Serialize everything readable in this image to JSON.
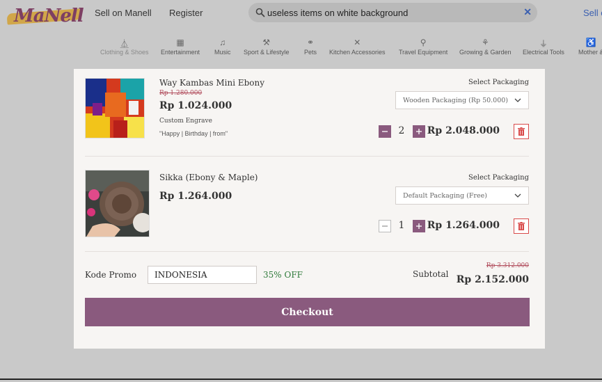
{
  "header": {
    "logo_text": "MaNell",
    "sell_link": "Sell on Manell",
    "register_link": "Register",
    "search": {
      "value": "useless items on white background",
      "placeholder": ""
    },
    "sell_right": "Sell o"
  },
  "categories": [
    {
      "label": "Clothing & Shoes",
      "icon": "hanger-icon"
    },
    {
      "label": "Entertainment",
      "icon": "film-icon"
    },
    {
      "label": "Music",
      "icon": "music-note-icon"
    },
    {
      "label": "Sport & Lifestyle",
      "icon": "dumbbell-icon"
    },
    {
      "label": "Pets",
      "icon": "bone-icon"
    },
    {
      "label": "Kitchen Accessories",
      "icon": "utensils-icon"
    },
    {
      "label": "Travel Equipment",
      "icon": "binoculars-icon"
    },
    {
      "label": "Growing & Garden",
      "icon": "plant-icon"
    },
    {
      "label": "Electrical Tools",
      "icon": "plug-icon"
    },
    {
      "label": "Mother &",
      "icon": "stroller-icon"
    }
  ],
  "cart": {
    "items": [
      {
        "name": "Way Kambas Mini Ebony",
        "original_price": "Rp 1.280.000",
        "price": "Rp 1.024.000",
        "engrave_label": "Custom Engrave",
        "engrave_value": "\"Happy | Birthday | from\"",
        "packaging_label": "Select Packaging",
        "packaging_value": "Wooden Packaging (Rp 50.000)",
        "quantity": "2",
        "line_total": "Rp 2.048.000"
      },
      {
        "name": "Sikka (Ebony & Maple)",
        "price": "Rp 1.264.000",
        "packaging_label": "Select Packaging",
        "packaging_value": "Default Packaging (Free)",
        "quantity": "1",
        "line_total": "Rp 1.264.000"
      }
    ],
    "promo": {
      "label": "Kode Promo",
      "value": "INDONESIA",
      "discount": "35% OFF"
    },
    "subtotal": {
      "label": "Subtotal",
      "original": "Rp 3.312.000",
      "value": "Rp 2.152.000"
    },
    "checkout_label": "Checkout"
  },
  "colors": {
    "accent": "#8a5a7e",
    "danger": "#d94a4a",
    "discount": "#2f7a3a",
    "link": "#3a5fb0"
  }
}
